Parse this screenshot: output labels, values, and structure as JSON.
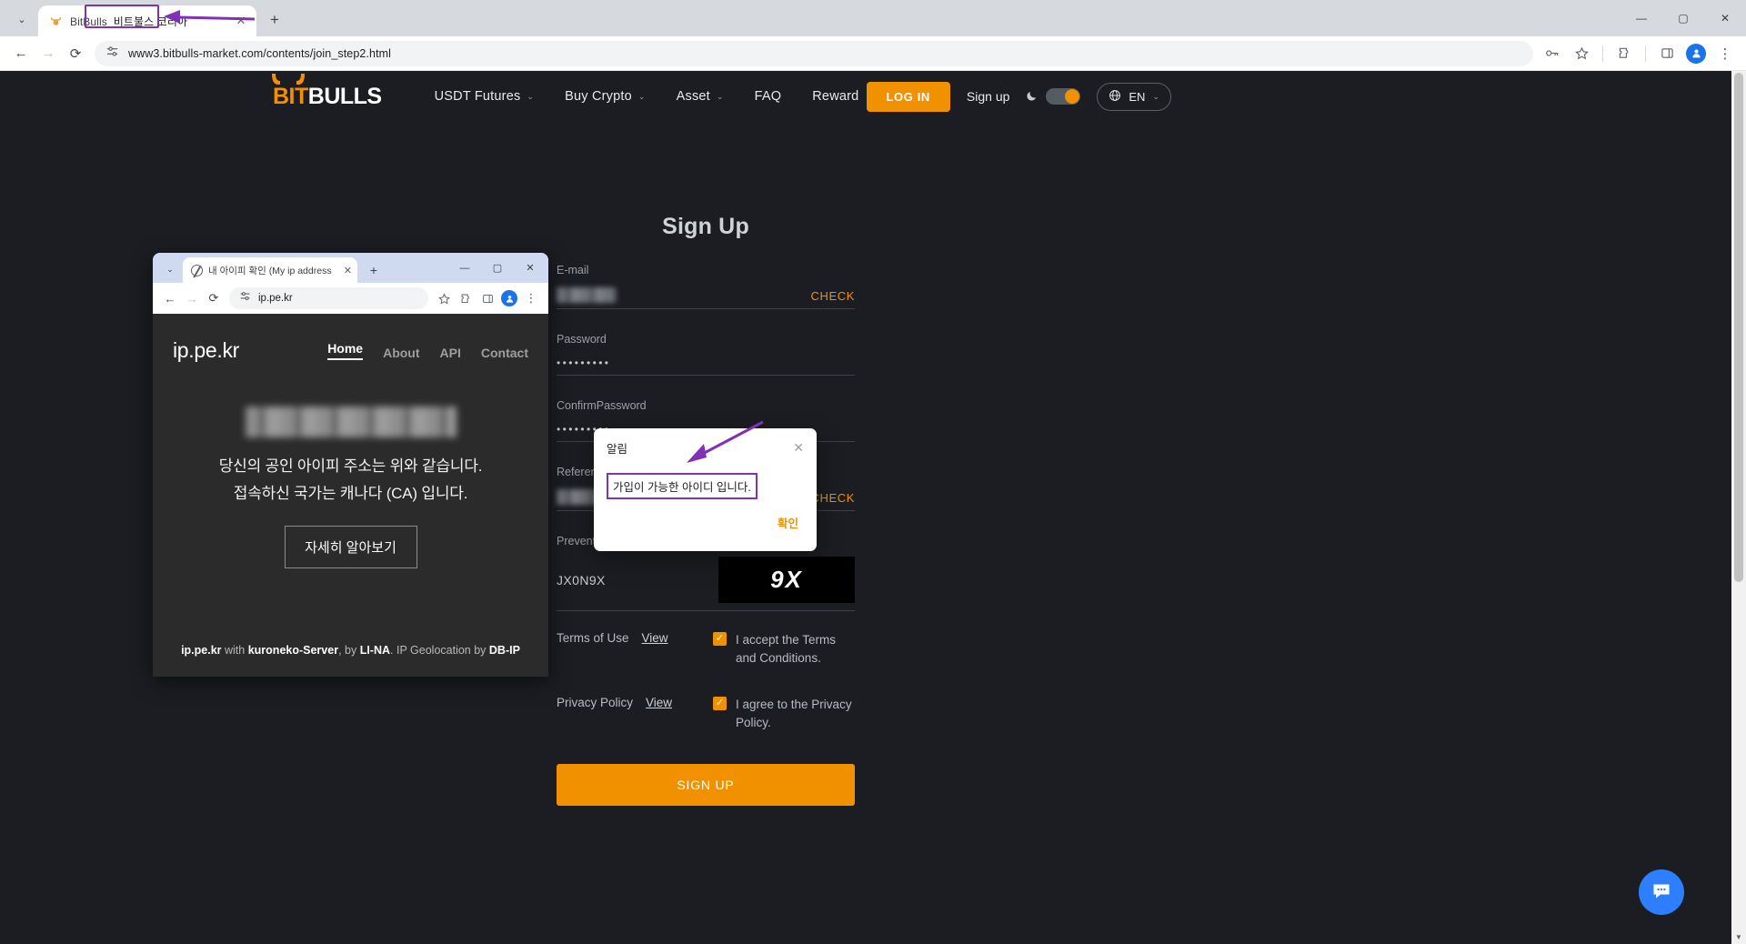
{
  "outer_browser": {
    "tabs": [
      {
        "favicon": "bull-icon",
        "title_en": "BitBulls",
        "title_kr": "비트불스 코리아",
        "close": "✕"
      }
    ],
    "new_tab_label": "+",
    "window_controls": {
      "minimize": "—",
      "maximize": "▢",
      "close": "✕"
    },
    "toolbar": {
      "back": "←",
      "forward": "→",
      "reload": "⟳",
      "site_info_icon": "tune-icon",
      "url": "www3.bitbulls-market.com/contents/join_step2.html",
      "password_icon": "key-icon",
      "bookmark_icon": "star-icon",
      "extensions_icon": "puzzle-icon",
      "sidepanel_icon": "panel-icon",
      "profile_icon": "avatar-icon",
      "menu_icon": "kebab-icon"
    }
  },
  "site": {
    "logo": {
      "part1": "BIT",
      "part2": "BULLS"
    },
    "nav": [
      {
        "label": "USDT Futures",
        "has_caret": true
      },
      {
        "label": "Buy Crypto",
        "has_caret": true
      },
      {
        "label": "Asset",
        "has_caret": true
      },
      {
        "label": "FAQ",
        "has_caret": false
      },
      {
        "label": "Reward",
        "has_caret": false
      }
    ],
    "login_label": "LOG IN",
    "signup_link": "Sign up",
    "dark_mode_icon": "moon-icon",
    "language": {
      "icon": "globe-icon",
      "value": "EN",
      "caret": "⌄"
    },
    "accent_color": "#f29100"
  },
  "signup_form": {
    "title": "Sign Up",
    "fields": [
      {
        "label": "E-mail",
        "value": "",
        "masked": true,
        "action": "CHECK"
      },
      {
        "label": "Password",
        "value": "•••••••••",
        "masked": false,
        "action": ""
      },
      {
        "label": "ConfirmPassword",
        "value": "•••••••••",
        "masked": false,
        "action": ""
      },
      {
        "label": "Reference code",
        "value": "",
        "masked": true,
        "action": "CHECK"
      }
    ],
    "captcha": {
      "label": "Prevent automatic registration",
      "value": "JX0N9X",
      "image_text": "9X"
    },
    "terms": [
      {
        "left_label": "Terms of Use",
        "view": "View",
        "checkbox_checked": true,
        "right_label": "I accept the Terms and Conditions."
      },
      {
        "left_label": "Privacy Policy",
        "view": "View",
        "checkbox_checked": true,
        "right_label": "I agree to the Privacy Policy."
      }
    ],
    "submit_label": "SIGN UP"
  },
  "modal": {
    "title": "알림",
    "close_icon": "✕",
    "message": "가입이 가능한 아이디 입니다.",
    "confirm_label": "확인",
    "highlight_color": "#8130b8"
  },
  "inner_browser": {
    "tab": {
      "title": "내 아이피 확인 (My ip address",
      "favicon": "globe-icon",
      "close": "✕"
    },
    "new_tab_label": "+",
    "window_controls": {
      "minimize": "—",
      "maximize": "▢",
      "close": "✕"
    },
    "toolbar": {
      "back": "←",
      "forward": "→",
      "reload": "⟳",
      "site_info_icon": "tune-icon",
      "url": "ip.pe.kr",
      "bookmark_icon": "star-icon",
      "extensions_icon": "puzzle-icon",
      "sidepanel_icon": "panel-icon",
      "profile_icon": "avatar-icon",
      "menu_icon": "kebab-icon"
    },
    "page": {
      "logo": "ip.pe.kr",
      "nav": [
        {
          "label": "Home",
          "active": true
        },
        {
          "label": "About",
          "active": false
        },
        {
          "label": "API",
          "active": false
        },
        {
          "label": "Contact",
          "active": false
        }
      ],
      "ip_masked": true,
      "line1": "당신의 공인 아이피 주소는 위와 같습니다.",
      "line2": "접속하신 국가는 캐나다 (CA) 입니다.",
      "button": "자세히 알아보기",
      "footer": {
        "p1": "ip.pe.kr",
        "p2": " with ",
        "p3": "kuroneko-Server",
        "p4": ", by ",
        "p5": "LI-NA",
        "p6": ". IP Geolocation by ",
        "p7": "DB-IP"
      }
    }
  },
  "chat_widget": {
    "icon": "chat-bubble-icon",
    "color": "#2d7fff"
  }
}
